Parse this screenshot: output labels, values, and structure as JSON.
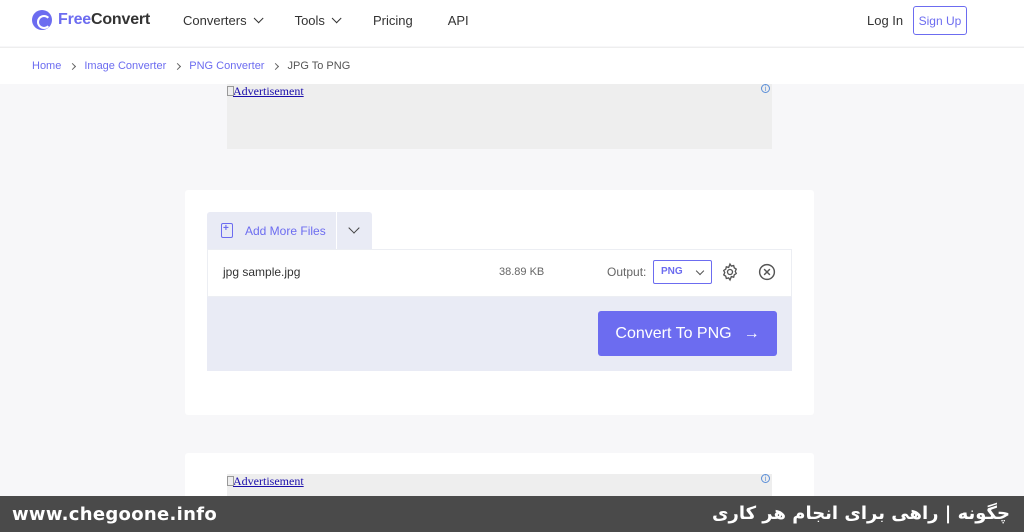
{
  "header": {
    "logo_prefix": "Free",
    "logo_suffix": "Convert",
    "nav": [
      {
        "label": "Converters"
      },
      {
        "label": "Tools"
      },
      {
        "label": "Pricing"
      },
      {
        "label": "API"
      }
    ],
    "login_label": "Log In",
    "signup_label": "Sign Up"
  },
  "breadcrumb": {
    "items": [
      "Home",
      "Image Converter",
      "PNG Converter"
    ],
    "current": "JPG To PNG"
  },
  "ads": {
    "top_text": "Advertisement",
    "bottom_text": "Advertisement",
    "info_glyph": "i"
  },
  "converter": {
    "add_files_label": "Add More Files",
    "file": {
      "name": "jpg sample.jpg",
      "size": "38.89 KB",
      "output_label": "Output:",
      "output_value": "PNG"
    },
    "convert_label": "Convert To PNG",
    "convert_arrow": "→"
  },
  "watermark": {
    "site": "www.chegoone.info",
    "tagline": "چگونه | راهی برای انجام هر کاری"
  },
  "colors": {
    "accent": "#6c6cf0",
    "panel": "#e9ebf5"
  }
}
